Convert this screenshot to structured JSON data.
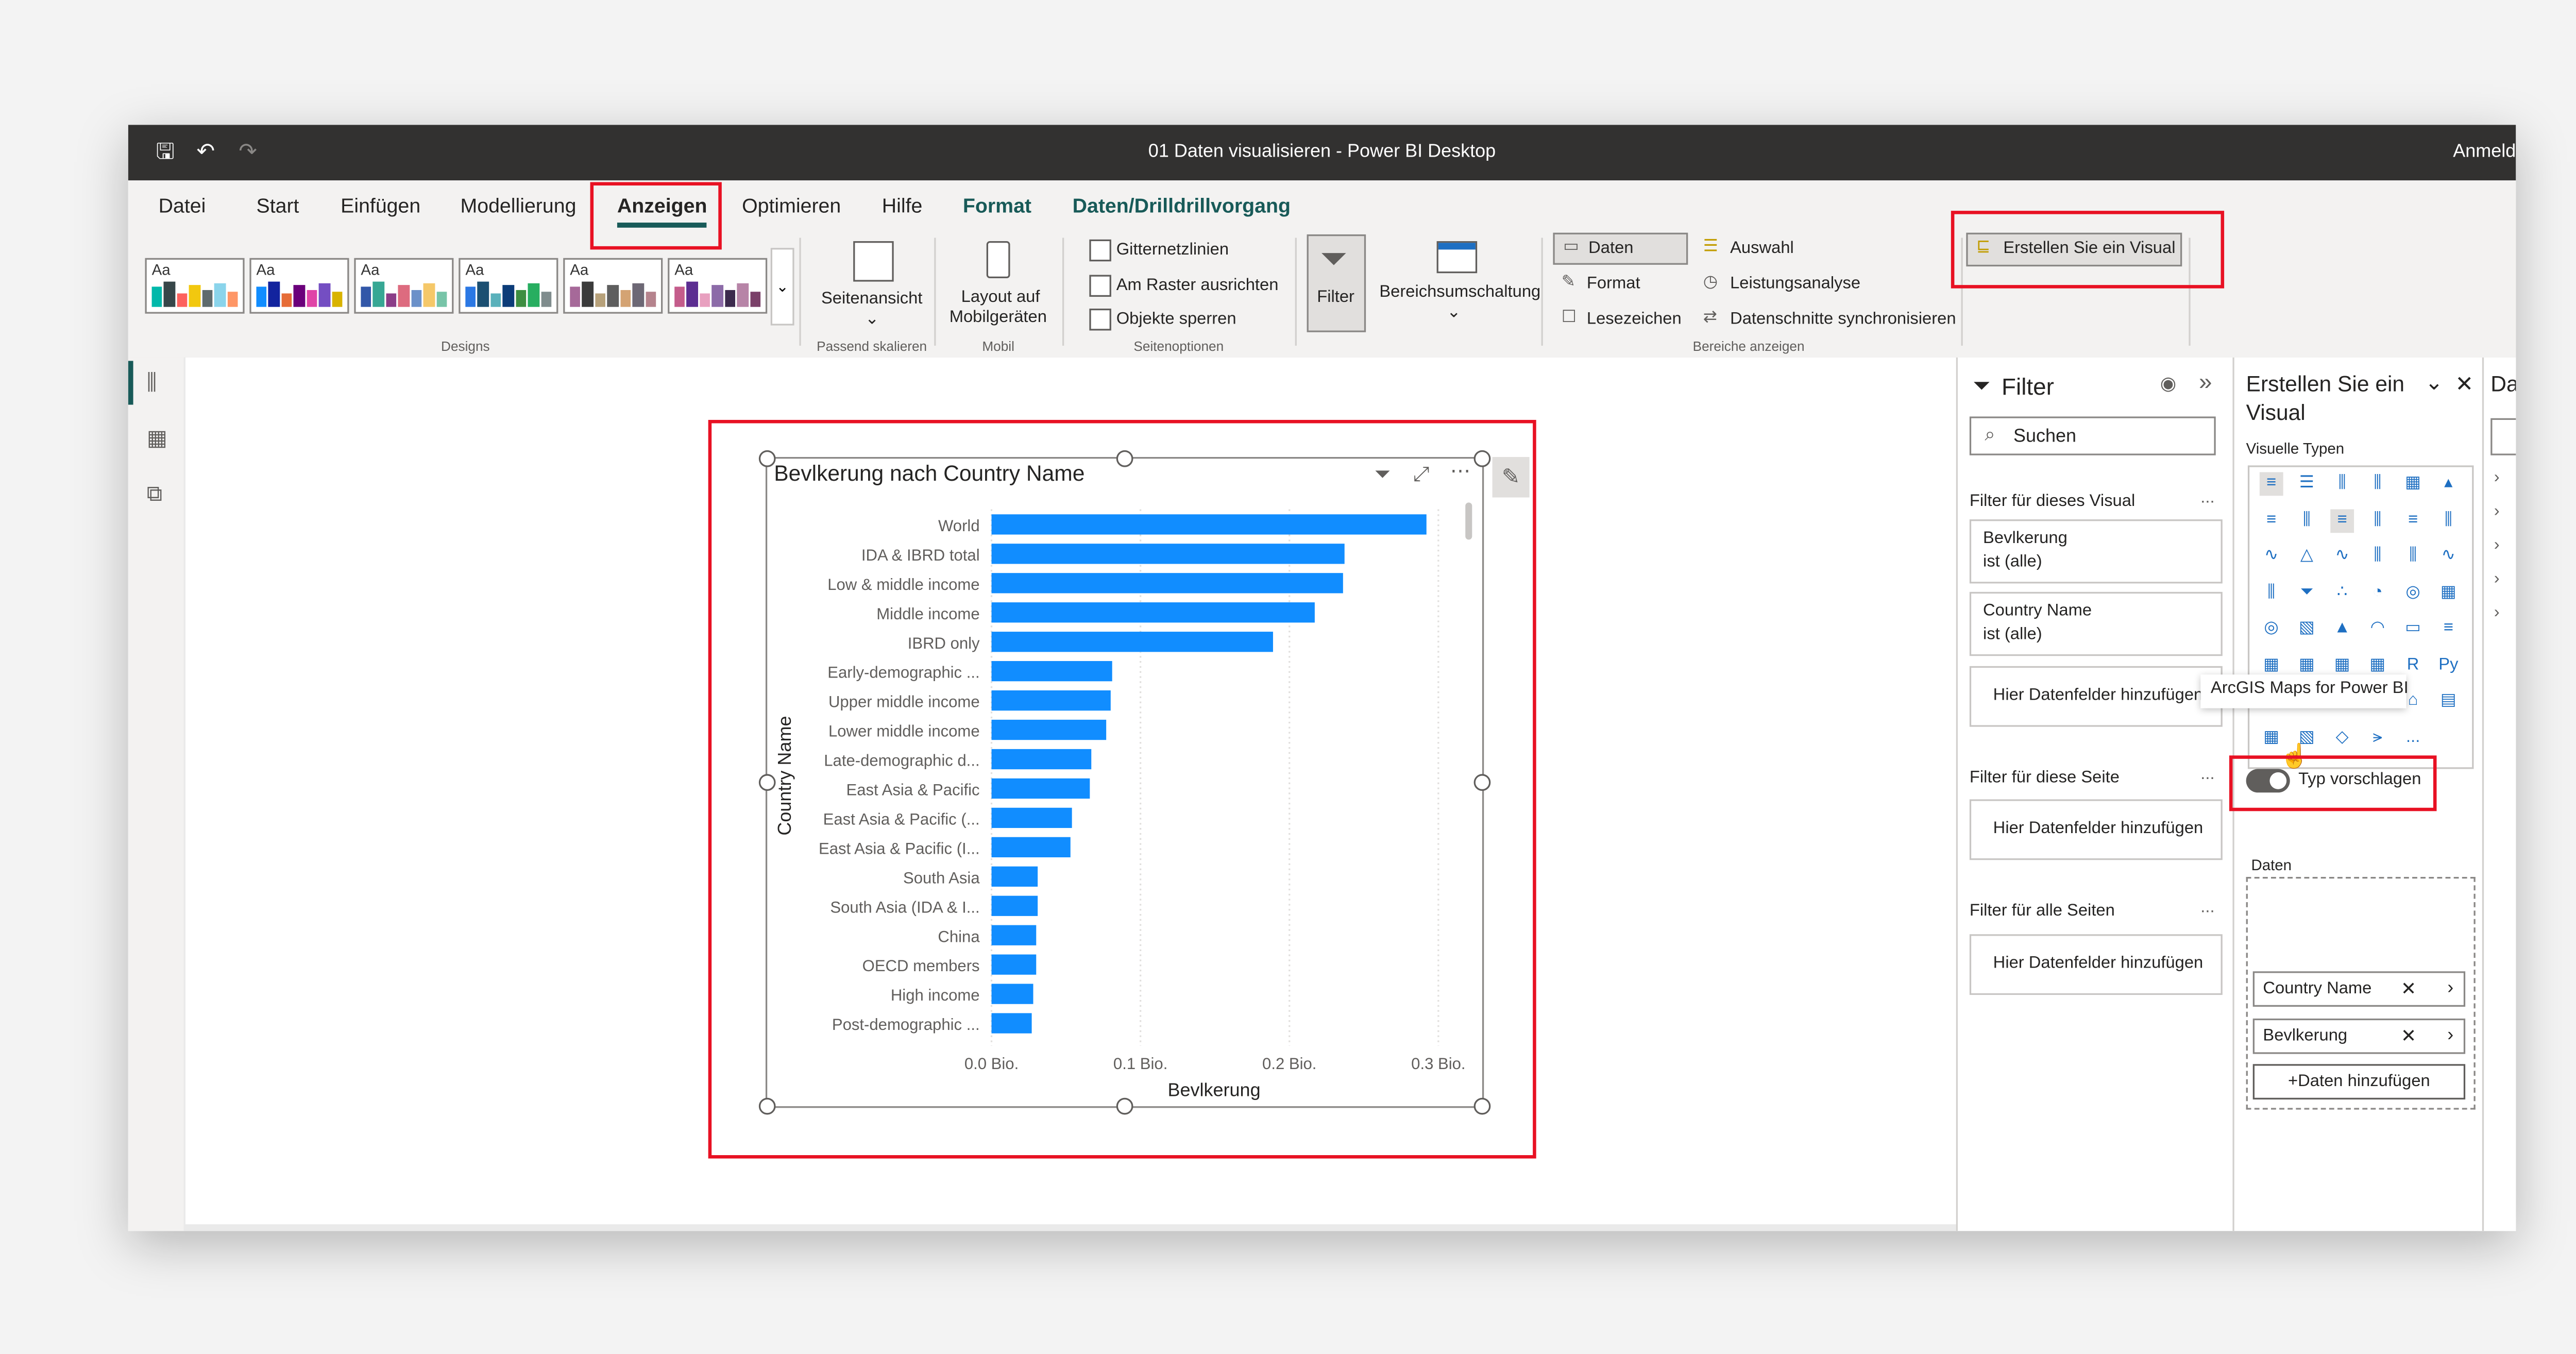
{
  "window": {
    "title": "01 Daten visualisieren - Power BI Desktop",
    "account": "Anmeld"
  },
  "tabs": [
    "Datei",
    "Start",
    "Einfügen",
    "Modellierung",
    "Anzeigen",
    "Optimieren",
    "Hilfe",
    "Format",
    "Daten/Drilldrillvorgang"
  ],
  "ribbon": {
    "designs_label": "Designs",
    "theme_glyph": "Aa",
    "seitenansicht": "Seitenansicht",
    "passend_label": "Passend skalieren",
    "layout_mobil": [
      "Layout auf",
      "Mobilgeräten"
    ],
    "mobil_label": "Mobil",
    "gitternetzlinien": "Gitternetzlinien",
    "am_raster": "Am Raster ausrichten",
    "objekte_sperren": "Objekte sperren",
    "seitenoptionen_label": "Seitenoptionen",
    "filter": "Filter",
    "bereichsumschaltung": "Bereichsumschaltung",
    "daten": "Daten",
    "format": "Format",
    "lesezeichen": "Lesezeichen",
    "auswahl": "Auswahl",
    "leistungsanalyse": "Leistungsanalyse",
    "datenschnitte": "Datenschnitte synchronisieren",
    "bereiche_label": "Bereiche anzeigen",
    "erstellen_visual": "Erstellen Sie ein Visual"
  },
  "filter_pane": {
    "title": "Filter",
    "search_placeholder": "Suchen",
    "visual_section": "Filter für dieses Visual",
    "card1_name": "Bevlkerung",
    "card1_value": "ist (alle)",
    "card2_name": "Country Name",
    "card2_value": "ist (alle)",
    "add_fields": "Hier Datenfelder hinzufügen",
    "page_section": "Filter für diese Seite",
    "all_section": "Filter für alle Seiten",
    "more": "..."
  },
  "viz_pane": {
    "title_l1": "Erstellen Sie ein",
    "title_l2": "Visual",
    "types_label": "Visuelle Typen",
    "tooltip": "ArcGIS Maps for Power BI",
    "suggest_type": "Typ vorschlagen",
    "data_label": "Daten",
    "field1": "Country Name",
    "field2": "Bevlkerung",
    "add_data": "+Daten hinzufügen",
    "py_glyph": "Py",
    "r_glyph": "R",
    "more_glyph": "..."
  },
  "data_pane": {
    "title": "Da"
  },
  "chart_data": {
    "type": "bar",
    "orientation": "horizontal",
    "title": "Bevlkerung nach Country Name",
    "xlabel": "Bevlkerung",
    "ylabel": "Country Name",
    "categories": [
      "World",
      "IDA & IBRD total",
      "Low & middle income",
      "Middle income",
      "IBRD only",
      "Early-demographic ...",
      "Upper middle income",
      "Lower middle income",
      "Late-demographic d...",
      "East Asia & Pacific",
      "East Asia & Pacific (...",
      "East Asia & Pacific (I...",
      "South Asia",
      "South Asia (IDA & I...",
      "China",
      "OECD members",
      "High income",
      "Post-demographic ..."
    ],
    "values": [
      0.292,
      0.237,
      0.236,
      0.217,
      0.189,
      0.081,
      0.08,
      0.077,
      0.067,
      0.066,
      0.054,
      0.053,
      0.031,
      0.031,
      0.03,
      0.03,
      0.028,
      0.027
    ],
    "x_ticks": [
      "0.0 Bio.",
      "0.1 Bio.",
      "0.2 Bio.",
      "0.3 Bio."
    ],
    "xlim": [
      0,
      0.3
    ],
    "bar_color": "#118dff",
    "grid": true
  }
}
